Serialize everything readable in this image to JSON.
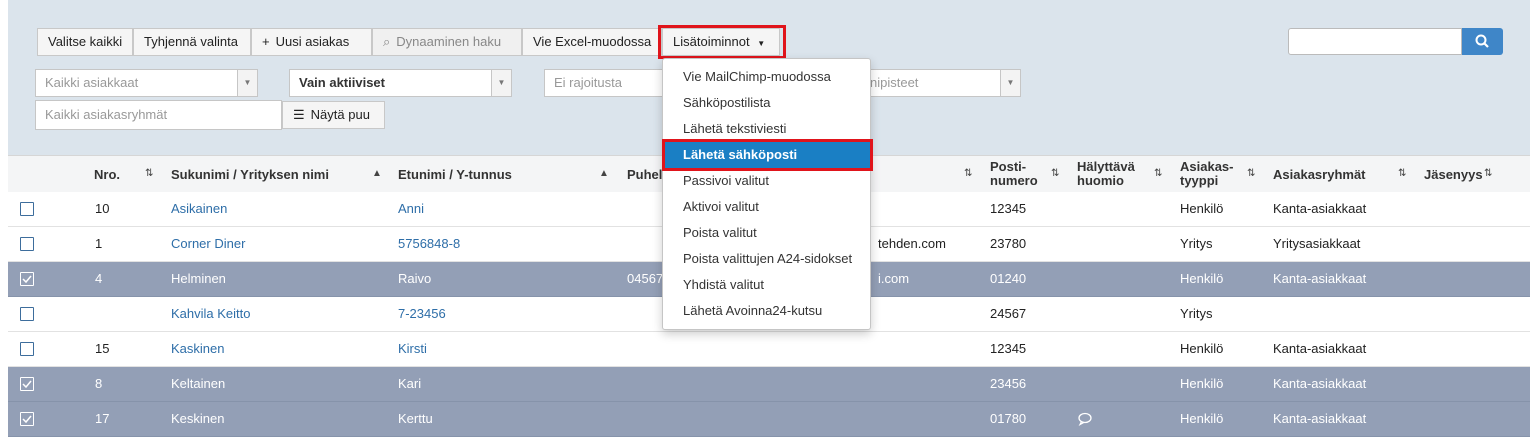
{
  "toolbar": {
    "select_all": "Valitse kaikki",
    "clear_selection": "Tyhjennä valinta",
    "new_customer": "Uusi asiakas",
    "new_customer_icon": "+",
    "dynamic_search": "Dynaaminen haku",
    "dynamic_search_icon": "⌕",
    "excel_export": "Vie Excel-muodossa",
    "more_actions": "Lisätoiminnot",
    "more_actions_caret": "▼"
  },
  "filters": {
    "customers": "Kaikki asiakkaat",
    "active": "Vain aktiiviset",
    "restriction": "Ei rajoitusta",
    "points": "nipisteet",
    "groups_placeholder": "Kaikki asiakasryhmät",
    "show_tree": "Näytä puu",
    "show_tree_icon": "☰"
  },
  "search": {
    "value": ""
  },
  "table": {
    "headers": {
      "nro": "Nro.",
      "surname": "Sukunimi / Yrityksen nimi",
      "firstname": "Etunimi / Y-tunnus",
      "phone": "Puhel",
      "postal_1": "Posti-",
      "postal_2": "numero",
      "alert_1": "Hälyttävä",
      "alert_2": "huomio",
      "type_1": "Asiakas-",
      "type_2": "tyyppi",
      "groups": "Asiakasryhmät",
      "membership": "Jäsenyys"
    },
    "rows": [
      {
        "checked": "☐",
        "nro": "10",
        "surname": "Asikainen",
        "firstname": "Anni",
        "phone": "",
        "email": "",
        "postal": "12345",
        "alert": "",
        "type": "Henkilö",
        "groups": "Kanta-asiakkaat"
      },
      {
        "checked": "☐",
        "nro": "1",
        "surname": "Corner Diner",
        "firstname": "5756848-8",
        "phone": "",
        "email": "tehden.com",
        "postal": "23780",
        "alert": "",
        "type": "Yritys",
        "groups": "Yritysasiakkaat"
      },
      {
        "checked": "☑",
        "nro": "4",
        "surname": "Helminen",
        "firstname": "Raivo",
        "phone": "04567",
        "email": "i.com",
        "postal": "01240",
        "alert": "",
        "type": "Henkilö",
        "groups": "Kanta-asiakkaat"
      },
      {
        "checked": "☐",
        "nro": "",
        "surname": "Kahvila Keitto",
        "firstname": "7-23456",
        "phone": "",
        "email": "",
        "postal": "24567",
        "alert": "",
        "type": "Yritys",
        "groups": ""
      },
      {
        "checked": "☐",
        "nro": "15",
        "surname": "Kaskinen",
        "firstname": "Kirsti",
        "phone": "",
        "email": "",
        "postal": "12345",
        "alert": "",
        "type": "Henkilö",
        "groups": "Kanta-asiakkaat"
      },
      {
        "checked": "☑",
        "nro": "8",
        "surname": "Keltainen",
        "firstname": "Kari",
        "phone": "",
        "email": "",
        "postal": "23456",
        "alert": "",
        "type": "Henkilö",
        "groups": "Kanta-asiakkaat"
      },
      {
        "checked": "☑",
        "nro": "17",
        "surname": "Keskinen",
        "firstname": "Kerttu",
        "phone": "",
        "email": "",
        "postal": "01780",
        "alert": "comment-icon",
        "type": "Henkilö",
        "groups": "Kanta-asiakkaat"
      }
    ]
  },
  "dropdown": {
    "items": [
      "Vie MailChimp-muodossa",
      "Sähköpostilista",
      "Lähetä tekstiviesti",
      "Lähetä sähköposti",
      "Passivoi valitut",
      "Aktivoi valitut",
      "Poista valitut",
      "Poista valittujen A24-sidokset",
      "Yhdistä valitut",
      "Lähetä Avoinna24-kutsu"
    ],
    "active_index": 3
  },
  "colors": {
    "highlight": "#e0141b",
    "selected_row": "#939fb6",
    "link": "#2e6ea8",
    "dropdown_active": "#1a7fc4",
    "search_button": "#3f86c8"
  }
}
